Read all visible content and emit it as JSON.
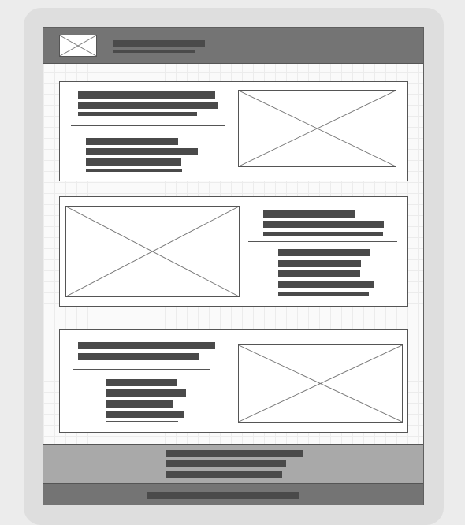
{
  "colors": {
    "device_frame": "#dedede",
    "background": "#ececec",
    "header": "#747474",
    "footer_top": "#a9a9a9",
    "footer_bottom": "#747474",
    "text_placeholder": "#4a4a4a",
    "outline": "#555555"
  },
  "header": {
    "logo": "image-placeholder-icon",
    "text_lines": 2
  },
  "sections": [
    {
      "layout": "text-left-image-right",
      "heading_lines": 3,
      "body_lines": 4,
      "image": "image-placeholder-icon"
    },
    {
      "layout": "image-left-text-right",
      "heading_lines": 3,
      "body_lines": 5,
      "image": "image-placeholder-icon"
    },
    {
      "layout": "text-left-image-right",
      "heading_lines": 2,
      "body_lines": 5,
      "image": "image-placeholder-icon"
    }
  ],
  "footer": {
    "text_lines": 3,
    "bottom_lines": 1
  }
}
